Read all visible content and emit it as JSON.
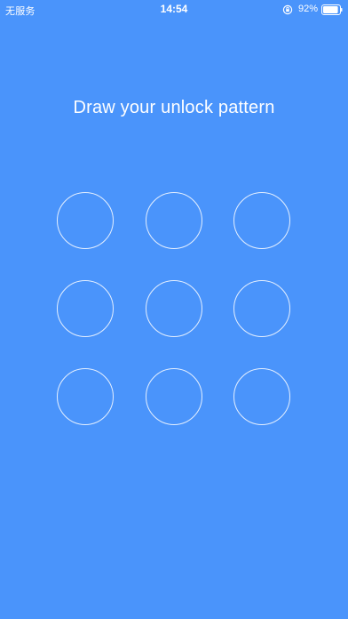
{
  "status_bar": {
    "carrier": "无服务",
    "time": "14:54",
    "battery_percent": "92%",
    "battery_level": 0.92,
    "icons": [
      "rotation-lock-icon",
      "battery-icon"
    ]
  },
  "title": "Draw your unlock pattern",
  "pattern": {
    "rows": 3,
    "cols": 3,
    "dot_count": 9
  },
  "colors": {
    "background": "#4a94fb",
    "foreground": "#ffffff"
  }
}
